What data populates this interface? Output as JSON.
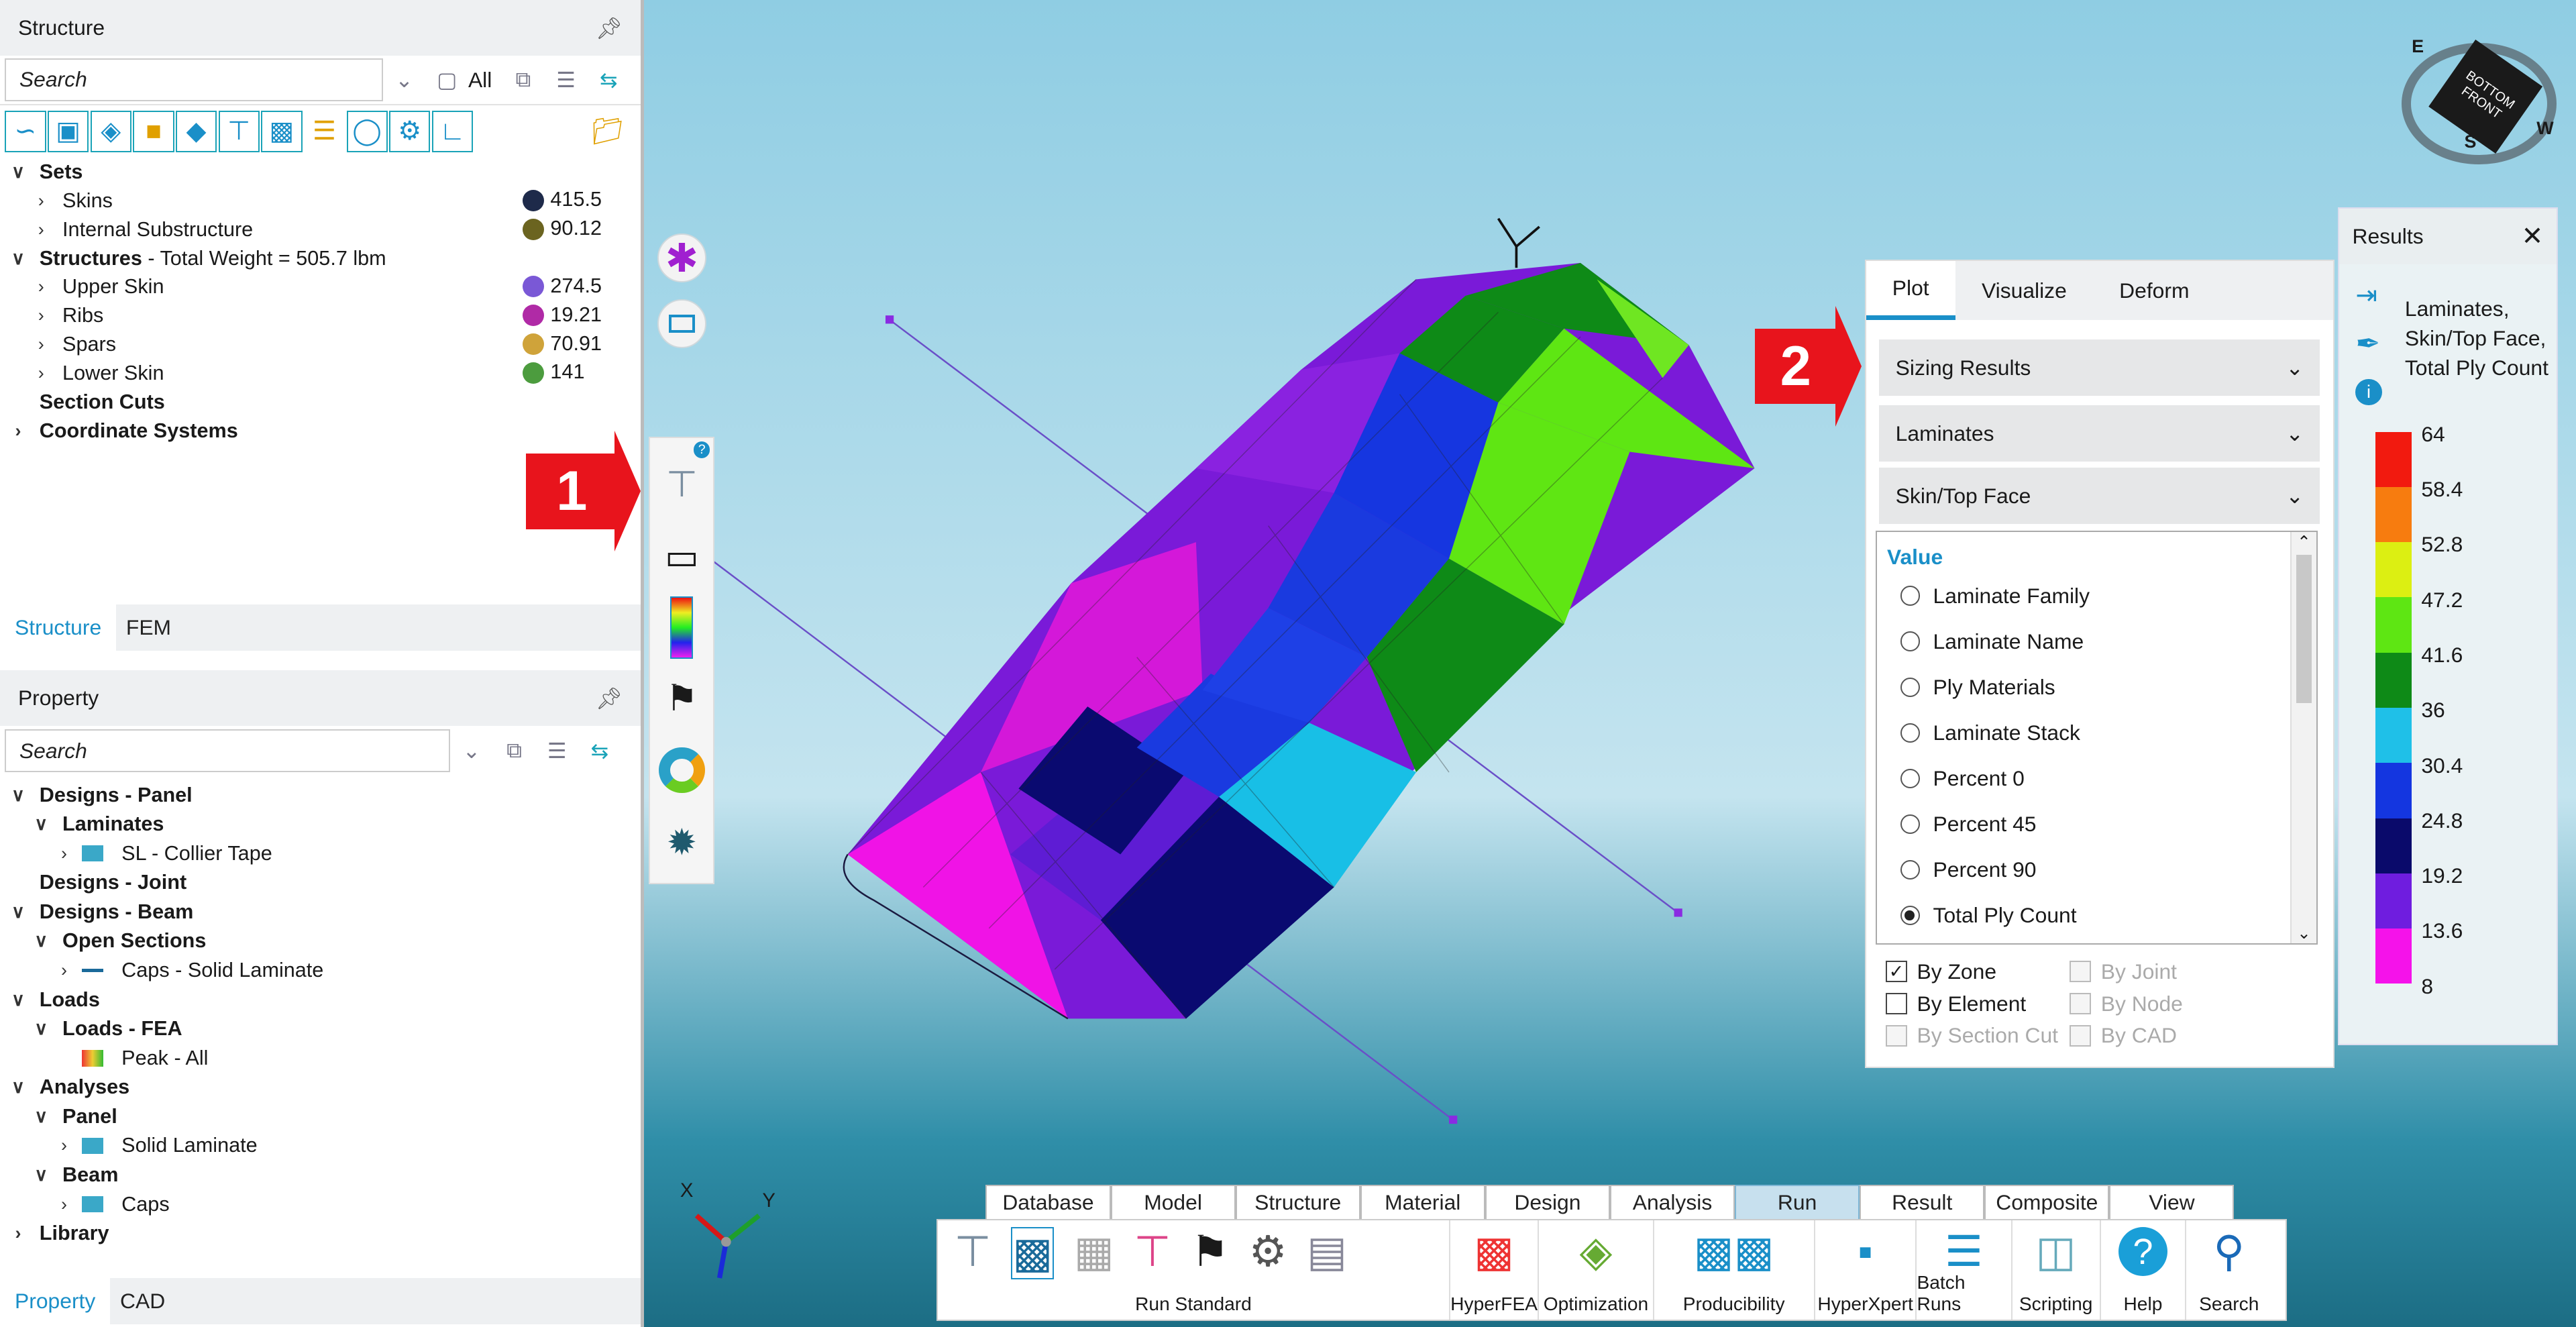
{
  "structure_panel": {
    "title": "Structure",
    "search_placeholder": "Search",
    "filter_label": "All",
    "tree": [
      {
        "label": "Sets",
        "bold": true,
        "level": 0,
        "expanded": true
      },
      {
        "label": "Skins",
        "level": 1,
        "value": "415.5",
        "color": "#1e2a4a"
      },
      {
        "label": "Internal Substructure",
        "level": 1,
        "value": "90.12",
        "color": "#6b6420"
      },
      {
        "label": "Structures",
        "suffix": " - Total Weight = 505.7 lbm",
        "bold": true,
        "level": 0,
        "expanded": true
      },
      {
        "label": "Upper Skin",
        "level": 1,
        "value": "274.5",
        "color": "#7a58d6"
      },
      {
        "label": "Ribs",
        "level": 1,
        "value": "19.21",
        "color": "#b02aa6"
      },
      {
        "label": "Spars",
        "level": 1,
        "value": "70.91",
        "color": "#cfa33a"
      },
      {
        "label": "Lower Skin",
        "level": 1,
        "value": "141",
        "color": "#4c9c3e"
      },
      {
        "label": "Section Cuts",
        "bold": true,
        "level": 0,
        "noexp": true
      },
      {
        "label": "Coordinate Systems",
        "bold": true,
        "level": 0,
        "expanded": false
      }
    ],
    "tabs": [
      "Structure",
      "FEM"
    ]
  },
  "property_panel": {
    "title": "Property",
    "search_placeholder": "Search",
    "tree": [
      {
        "label": "Designs - Panel",
        "bold": true,
        "level": 0,
        "expanded": true
      },
      {
        "label": "Laminates",
        "bold": true,
        "level": 1,
        "expanded": true
      },
      {
        "label": "SL - Collier Tape",
        "level": 2,
        "icon": "laminate-icon"
      },
      {
        "label": "Designs - Joint",
        "bold": true,
        "level": 0,
        "noexp": true
      },
      {
        "label": "Designs - Beam",
        "bold": true,
        "level": 0,
        "expanded": true
      },
      {
        "label": "Open Sections",
        "bold": true,
        "level": 1,
        "expanded": true
      },
      {
        "label": "Caps - Solid Laminate",
        "level": 2,
        "icon": "beam-icon"
      },
      {
        "label": "Loads",
        "bold": true,
        "level": 0,
        "expanded": true
      },
      {
        "label": "Loads - FEA",
        "bold": true,
        "level": 1,
        "expanded": true
      },
      {
        "label": "Peak - All",
        "level": 2,
        "icon": "load-icon",
        "noexp": true
      },
      {
        "label": "Analyses",
        "bold": true,
        "level": 0,
        "expanded": true
      },
      {
        "label": "Panel",
        "bold": true,
        "level": 1,
        "expanded": true
      },
      {
        "label": "Solid Laminate",
        "level": 2,
        "icon": "panel-icon"
      },
      {
        "label": "Beam",
        "bold": true,
        "level": 1,
        "expanded": true
      },
      {
        "label": "Caps",
        "level": 2,
        "icon": "i-beam-icon"
      },
      {
        "label": "Library",
        "bold": true,
        "level": 0,
        "expanded": false
      }
    ],
    "tabs": [
      "Property",
      "CAD"
    ]
  },
  "callouts": [
    "1",
    "2"
  ],
  "plot_panel": {
    "tabs": [
      "Plot",
      "Visualize",
      "Deform"
    ],
    "dropdowns": [
      "Sizing Results",
      "Laminates",
      "Skin/Top Face"
    ],
    "value_header": "Value",
    "options": [
      "Laminate Family",
      "Laminate Name",
      "Ply Materials",
      "Laminate Stack",
      "Percent 0",
      "Percent 45",
      "Percent 90",
      "Total Ply Count"
    ],
    "selected": "Total Ply Count",
    "checks": [
      {
        "label": "By Zone",
        "checked": true,
        "disabled": false
      },
      {
        "label": "By Joint",
        "checked": false,
        "disabled": true
      },
      {
        "label": "By Element",
        "checked": false,
        "disabled": false
      },
      {
        "label": "By Node",
        "checked": false,
        "disabled": true
      },
      {
        "label": "By Section Cut",
        "checked": false,
        "disabled": true
      },
      {
        "label": "By CAD",
        "checked": false,
        "disabled": true
      }
    ]
  },
  "results_panel": {
    "title": "Results",
    "legend_title": "Laminates, Skin/Top Face, Total Ply Count",
    "scale": [
      "64",
      "58.4",
      "52.8",
      "47.2",
      "41.6",
      "36",
      "30.4",
      "24.8",
      "19.2",
      "13.6",
      "8"
    ],
    "colors": [
      "#f21a0f",
      "#f77c0f",
      "#dcef12",
      "#5ee613",
      "#0e8a17",
      "#1fc0e8",
      "#1436e0",
      "#0a0a6b",
      "#6f1ddf",
      "#f512ea"
    ]
  },
  "ribbon": {
    "tabs": [
      "Database",
      "Model",
      "Structure",
      "Material",
      "Design",
      "Analysis",
      "Run",
      "Result",
      "Composite",
      "View"
    ],
    "active_tab": "Run",
    "groups": [
      "Run Standard",
      "HyperFEA",
      "Optimization",
      "Producibility",
      "HyperXpert",
      "Batch Runs",
      "Scripting",
      "Help",
      "Search"
    ]
  },
  "viewcube": {
    "faces": [
      "BOTTOM",
      "FRONT"
    ],
    "letters": [
      "E",
      "S",
      "W"
    ]
  },
  "triad": {
    "x": "X",
    "y": "Y"
  }
}
